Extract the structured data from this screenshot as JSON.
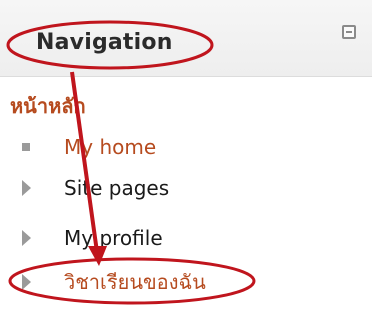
{
  "block": {
    "title": "Navigation",
    "collapse_icon": "collapse-minus-icon",
    "home_label": "หน้าหลัก",
    "items": [
      {
        "label": "My home",
        "icon": "bullet-icon",
        "style": "link"
      },
      {
        "label": "Site pages",
        "icon": "triangle-right-icon",
        "style": "text"
      },
      {
        "label": "My profile",
        "icon": "triangle-right-icon",
        "style": "text"
      },
      {
        "label": "วิชาเรียนของฉัน",
        "icon": "triangle-right-icon",
        "style": "link"
      }
    ]
  },
  "colors": {
    "link": "#b64b1f",
    "annotation": "#c0151d",
    "icon": "#9a9a9a"
  }
}
